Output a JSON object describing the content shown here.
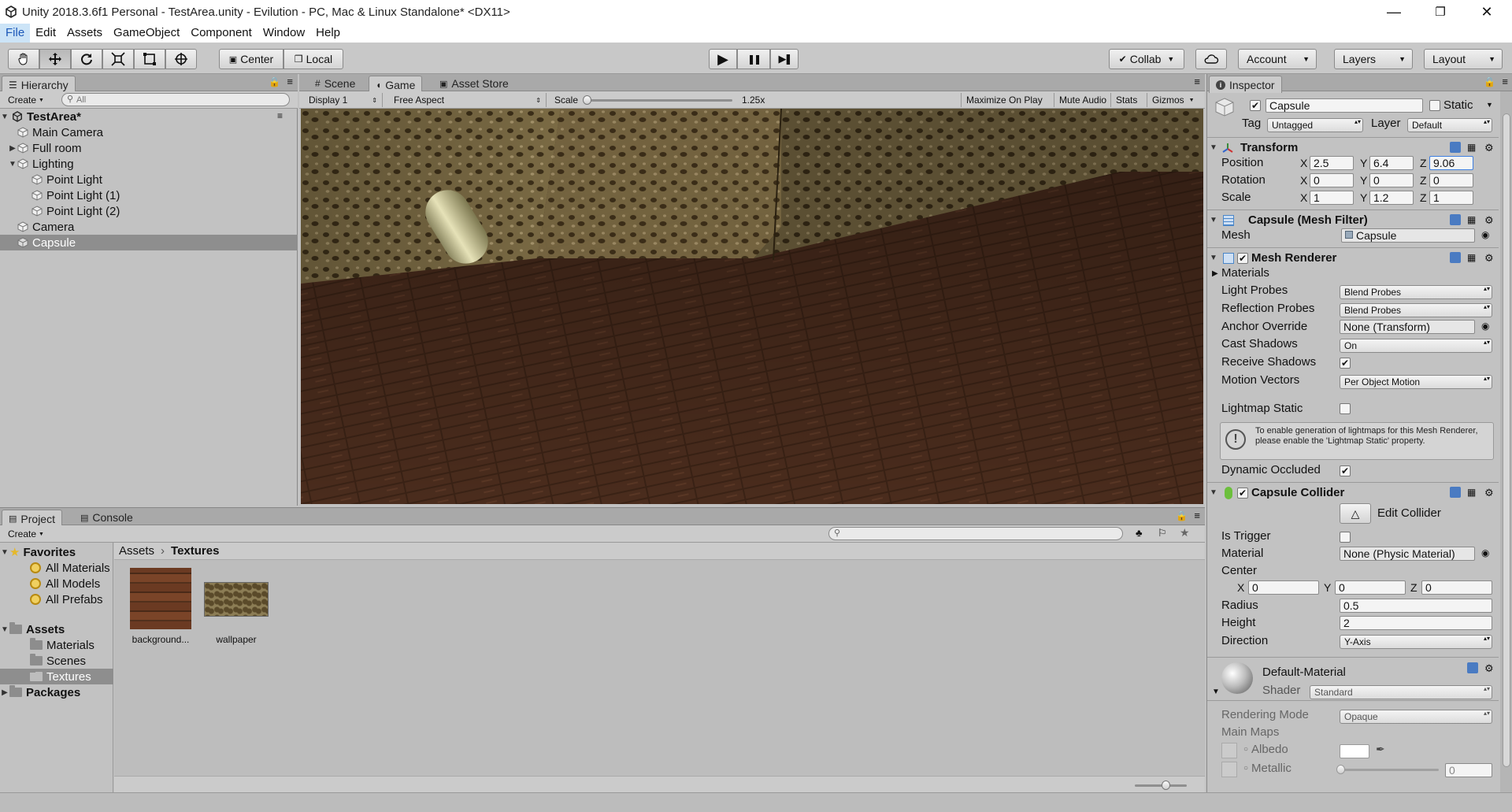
{
  "window": {
    "title": "Unity 2018.3.6f1 Personal - TestArea.unity - Evilution - PC, Mac & Linux Standalone* <DX11>",
    "minimize_glyph": "—",
    "maximize_glyph": "❐",
    "close_glyph": "✕"
  },
  "menu": [
    "File",
    "Edit",
    "Assets",
    "GameObject",
    "Component",
    "Window",
    "Help"
  ],
  "toolbar": {
    "tools": [
      "hand-tool-icon",
      "move-tool-icon",
      "rotate-tool-icon",
      "scale-tool-icon",
      "rect-tool-icon",
      "transform-tool-icon"
    ],
    "pivot_mode": "Center",
    "pivot_rotation": "Local",
    "play_glyph": "▶",
    "pause_glyph": "❚❚",
    "step_glyph": "▶❚",
    "collab": "Collab",
    "account": "Account",
    "layers": "Layers",
    "layout": "Layout"
  },
  "hierarchy": {
    "tab": "Hierarchy",
    "create": "Create",
    "search_placeholder": "All",
    "scene": "TestArea*",
    "items": [
      {
        "label": "Main Camera",
        "depth": 1,
        "expand": ""
      },
      {
        "label": "Full room",
        "depth": 1,
        "expand": "▶"
      },
      {
        "label": "Lighting",
        "depth": 1,
        "expand": "▼"
      },
      {
        "label": "Point Light",
        "depth": 2,
        "expand": ""
      },
      {
        "label": "Point Light (1)",
        "depth": 2,
        "expand": ""
      },
      {
        "label": "Point Light (2)",
        "depth": 2,
        "expand": ""
      },
      {
        "label": "Camera",
        "depth": 1,
        "expand": ""
      },
      {
        "label": "Capsule",
        "depth": 1,
        "expand": "",
        "selected": true
      }
    ]
  },
  "game_view": {
    "tabs": [
      "Scene",
      "Game",
      "Asset Store"
    ],
    "display": "Display 1",
    "aspect": "Free Aspect",
    "scale_label": "Scale",
    "scale_value": "1.25x",
    "buttons": [
      "Maximize On Play",
      "Mute Audio",
      "Stats",
      "Gizmos"
    ]
  },
  "project": {
    "tabs": [
      "Project",
      "Console"
    ],
    "create": "Create",
    "favorites_label": "Favorites",
    "favorites": [
      "All Materials",
      "All Models",
      "All Prefabs"
    ],
    "assets_label": "Assets",
    "asset_folders": [
      "Materials",
      "Scenes",
      "Textures"
    ],
    "packages_label": "Packages",
    "breadcrumb": [
      "Assets",
      "Textures"
    ],
    "breadcrumb_sep": "›",
    "files": [
      {
        "name": "background..."
      },
      {
        "name": "wallpaper"
      }
    ]
  },
  "inspector": {
    "tab": "Inspector",
    "object_name": "Capsule",
    "static_label": "Static",
    "tag_label": "Tag",
    "tag_value": "Untagged",
    "layer_label": "Layer",
    "layer_value": "Default",
    "transform": {
      "title": "Transform",
      "position_label": "Position",
      "rotation_label": "Rotation",
      "scale_label": "Scale",
      "position": {
        "x": "2.5",
        "y": "6.4",
        "z": "9.06"
      },
      "rotation": {
        "x": "0",
        "y": "0",
        "z": "0"
      },
      "scale": {
        "x": "1",
        "y": "1.2",
        "z": "1"
      }
    },
    "mesh_filter": {
      "title": "Capsule (Mesh Filter)",
      "mesh_label": "Mesh",
      "mesh_value": "Capsule"
    },
    "mesh_renderer": {
      "title": "Mesh Renderer",
      "materials_label": "Materials",
      "light_probes_label": "Light Probes",
      "light_probes": "Blend Probes",
      "reflection_probes_label": "Reflection Probes",
      "reflection_probes": "Blend Probes",
      "anchor_override_label": "Anchor Override",
      "anchor_override": "None (Transform)",
      "cast_shadows_label": "Cast Shadows",
      "cast_shadows": "On",
      "receive_shadows_label": "Receive Shadows",
      "motion_vectors_label": "Motion Vectors",
      "motion_vectors": "Per Object Motion",
      "lightmap_static_label": "Lightmap Static",
      "info": "To enable generation of lightmaps for this Mesh Renderer, please enable the 'Lightmap Static' property.",
      "dynamic_occluded_label": "Dynamic Occluded"
    },
    "capsule_collider": {
      "title": "Capsule Collider",
      "edit_collider": "Edit Collider",
      "is_trigger_label": "Is Trigger",
      "material_label": "Material",
      "material": "None (Physic Material)",
      "center_label": "Center",
      "center": {
        "x": "0",
        "y": "0",
        "z": "0"
      },
      "radius_label": "Radius",
      "radius": "0.5",
      "height_label": "Height",
      "height": "2",
      "direction_label": "Direction",
      "direction": "Y-Axis"
    },
    "material": {
      "name": "Default-Material",
      "shader_label": "Shader",
      "shader": "Standard",
      "rendering_mode_label": "Rendering Mode",
      "rendering_mode": "Opaque",
      "main_maps_label": "Main Maps",
      "albedo_label": "Albedo",
      "metallic_label": "Metallic",
      "metallic_value": "0"
    },
    "axes": {
      "x": "X",
      "y": "Y",
      "z": "Z"
    },
    "check": "✔"
  }
}
